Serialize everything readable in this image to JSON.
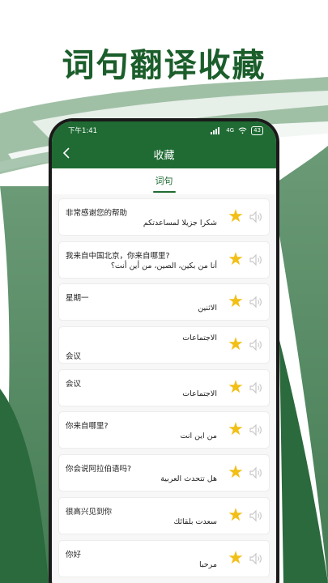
{
  "headline": "词句翻译收藏",
  "status_bar": {
    "time": "下午1:41",
    "signal": "4G",
    "battery": "43"
  },
  "app_bar": {
    "title": "收藏"
  },
  "tabs": [
    {
      "label": "词句"
    }
  ],
  "favorites": [
    {
      "zh": "非常感谢您的帮助",
      "ar": "شكرا جزيلا لمساعدتكم"
    },
    {
      "zh": "我来自中国北京，你来自哪里?",
      "ar": "أنا من بكين، الصين، من أين أنت؟"
    },
    {
      "zh": "星期一",
      "ar": "الاثنين"
    },
    {
      "zh": "会议",
      "ar": "الاجتماعات"
    },
    {
      "zh": "会议",
      "ar": "الاجتماعات"
    },
    {
      "zh": "你来自哪里?",
      "ar": "من اين انت"
    },
    {
      "zh": "你会说阿拉伯语吗?",
      "ar": "هل تتحدث العربية"
    },
    {
      "zh": "很高兴见到你",
      "ar": "سعدت بلقائك"
    },
    {
      "zh": "你好",
      "ar": "مرحبا"
    }
  ],
  "colors": {
    "brand_green": "#1f6b33",
    "star": "#f2bf17",
    "headline_green": "#1b5e2b"
  }
}
